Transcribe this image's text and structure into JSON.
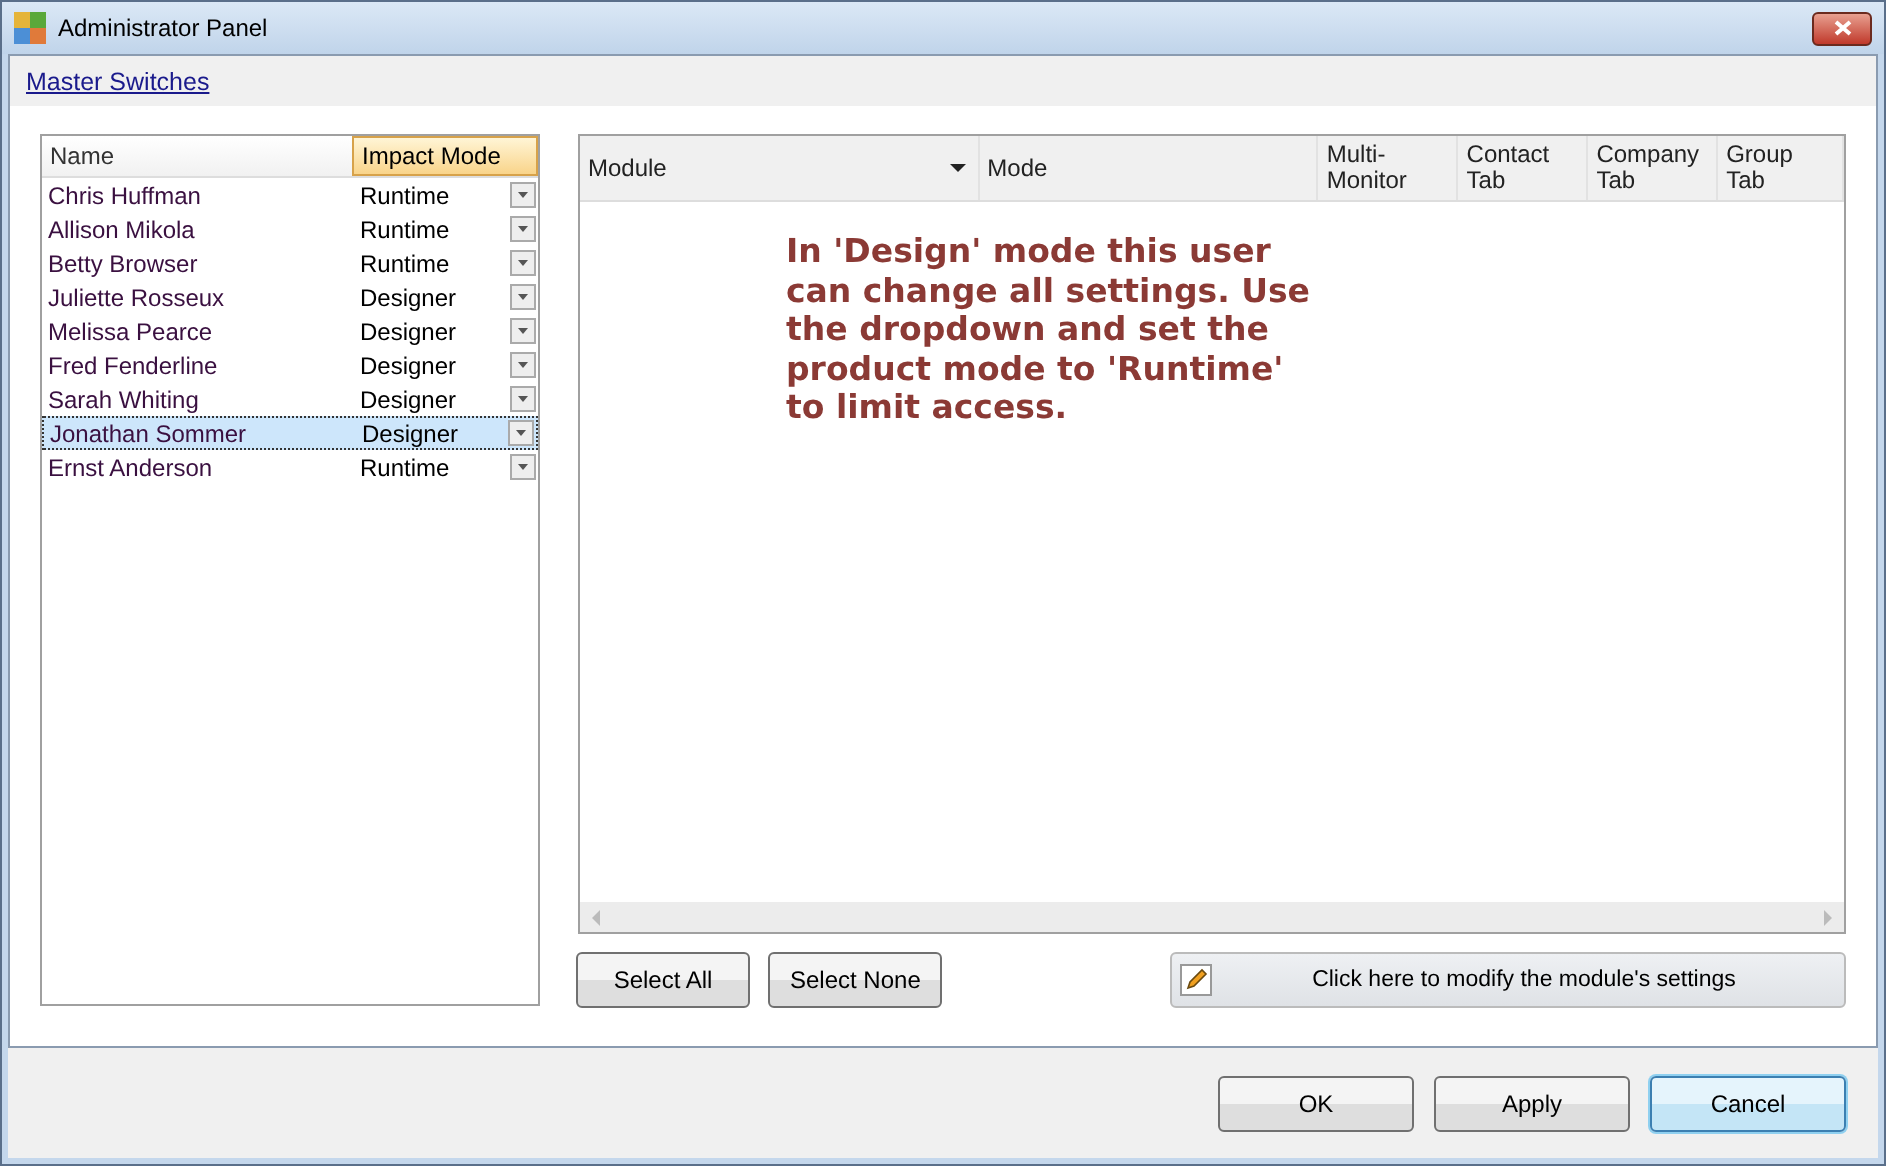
{
  "window": {
    "title": "Administrator Panel"
  },
  "link": "Master Switches",
  "user_list": {
    "columns": [
      {
        "label": "Name",
        "selected": false
      },
      {
        "label": "Impact Mode",
        "selected": true
      }
    ],
    "rows": [
      {
        "name": "Chris Huffman",
        "mode": "Runtime",
        "selected": false
      },
      {
        "name": "Allison Mikola",
        "mode": "Runtime",
        "selected": false
      },
      {
        "name": "Betty Browser",
        "mode": "Runtime",
        "selected": false
      },
      {
        "name": "Juliette Rosseux",
        "mode": "Designer",
        "selected": false
      },
      {
        "name": "Melissa Pearce",
        "mode": "Designer",
        "selected": false
      },
      {
        "name": "Fred Fenderline",
        "mode": "Designer",
        "selected": false
      },
      {
        "name": "Sarah Whiting",
        "mode": "Designer",
        "selected": false
      },
      {
        "name": "Jonathan Sommer",
        "mode": "Designer",
        "selected": true
      },
      {
        "name": "Ernst Anderson",
        "mode": "Runtime",
        "selected": false
      }
    ]
  },
  "module_grid": {
    "columns": [
      {
        "label": "Module",
        "filter": true
      },
      {
        "label": "Mode",
        "filter": false
      },
      {
        "label": "Multi-\nMonitor",
        "filter": false
      },
      {
        "label": "Contact\nTab",
        "filter": false
      },
      {
        "label": "Company\nTab",
        "filter": false
      },
      {
        "label": "Group\nTab",
        "filter": false
      }
    ],
    "message": "In 'Design' mode this user can change all settings. Use the dropdown and set the product mode to 'Runtime' to limit access."
  },
  "grid_buttons": [
    "Select All",
    "Select None"
  ],
  "modify_button": "Click here to modify the module's settings",
  "dialog_buttons": [
    {
      "label": "OK",
      "focused": false
    },
    {
      "label": "Apply",
      "focused": false
    },
    {
      "label": "Cancel",
      "focused": true
    }
  ]
}
